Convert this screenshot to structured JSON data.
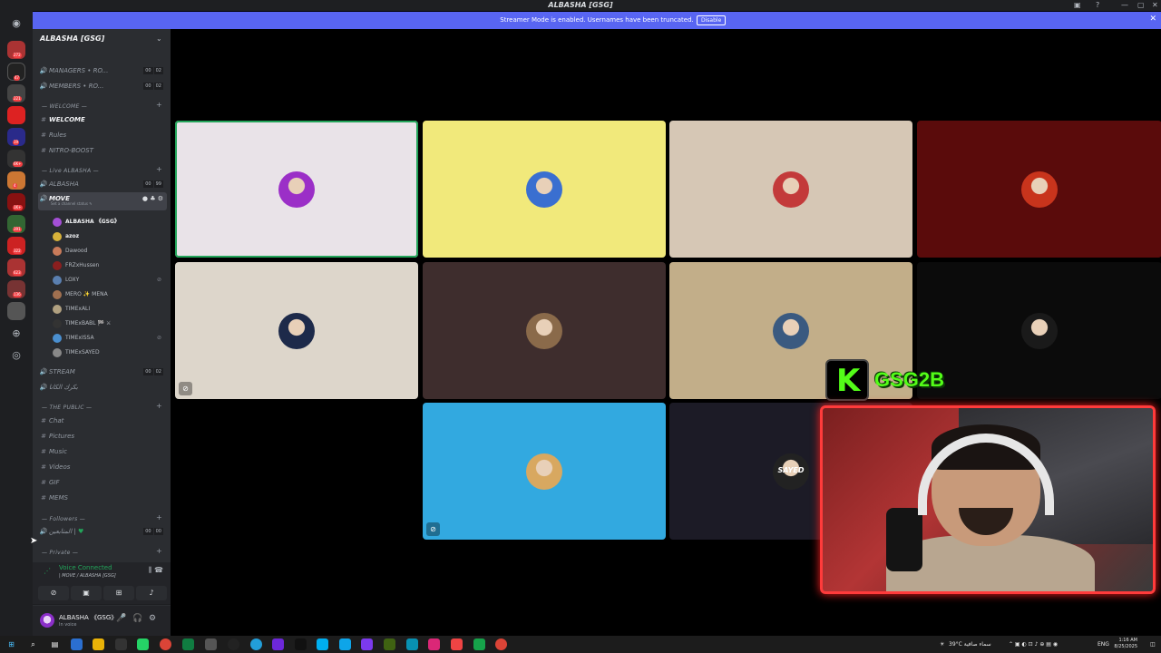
{
  "window": {
    "title": "ALBASHA [GSG]"
  },
  "banner": {
    "text": "Streamer Mode is enabled. Usernames have been truncated.",
    "button": "Disable",
    "close": "✕",
    "color": "#5865f2"
  },
  "guilds": [
    {
      "badge": "63"
    },
    {
      "badge": "272"
    },
    {
      "badge": "47"
    },
    {
      "badge": "221"
    },
    {
      "badge": ""
    },
    {
      "badge": "19"
    },
    {
      "badge": "6K+"
    },
    {
      "badge": "4"
    },
    {
      "badge": "1K+"
    },
    {
      "badge": "391"
    },
    {
      "badge": "322"
    },
    {
      "badge": "623"
    },
    {
      "badge": "136"
    },
    {
      "badge": ""
    }
  ],
  "sidebar": {
    "server_name": "ALBASHA [GSG]",
    "rows": {
      "managers": {
        "label": "MANAGERS • RO...",
        "c1": "00",
        "c2": "02"
      },
      "members": {
        "label": "MEMBERS • RO...",
        "c1": "00",
        "c2": "02"
      },
      "cat_welcome": "— WELCOME —",
      "welcome": "WELCOME",
      "rules": "Rules",
      "nitro": "NITRO-BOOST",
      "cat_live": "— Live ALBASHA —",
      "albasha": {
        "label": "ALBASHA",
        "c1": "00",
        "c2": "99"
      },
      "move": {
        "label": "MOVE",
        "status": "Set a channel status ✎"
      },
      "stream": {
        "label": "STREAM",
        "c1": "00",
        "c2": "02"
      },
      "arabic_vc": "بكرك الكانا",
      "cat_public": "— THE PUBLIC —",
      "chat": "Chat",
      "pictures": "Pictures",
      "music": "Music",
      "videos": "Videos",
      "gif": "GIF",
      "mems": "MEMS",
      "cat_followers": "— Followers —",
      "followers_vc": {
        "label": "المتابعين |",
        "c1": "00",
        "c2": "00"
      },
      "cat_private": "— Private —"
    },
    "members": [
      {
        "name": "ALBASHA 《GSG》",
        "color": "#a44fd6"
      },
      {
        "name": "azoz",
        "color": "#d8b23a"
      },
      {
        "name": "Dawood",
        "color": "#c97b5a"
      },
      {
        "name": "FRZxHussen",
        "color": "#8a1f1f"
      },
      {
        "name": "LOXY",
        "color": "#5a7fb0"
      },
      {
        "name": "MERO ✨ MENA",
        "color": "#a07050"
      },
      {
        "name": "TIMExALI",
        "color": "#b0a080"
      },
      {
        "name": "TIMExBABL 🏁 ⚔",
        "color": "#333333"
      },
      {
        "name": "TIMExISSA",
        "color": "#4a8fd0"
      },
      {
        "name": "TIMExSAYED",
        "color": "#888888"
      }
    ]
  },
  "voice_panel": {
    "title": "Voice Connected",
    "subtitle": "| MOVE / ALBASHA [GSG]"
  },
  "user_panel": {
    "name": "ALBASHA 《GSG》",
    "status": "In voice"
  },
  "tiles": [
    {
      "bg": "#e9e3e8",
      "avatar": "#9b2fc7",
      "speaking": true,
      "muted": false
    },
    {
      "bg": "#f1e97b",
      "avatar": "#3a6fd0",
      "speaking": false,
      "muted": false
    },
    {
      "bg": "#d6c7b5",
      "avatar": "#c33a3a",
      "speaking": false,
      "muted": false
    },
    {
      "bg": "#5a0b0b",
      "avatar": "#c8341c",
      "speaking": false,
      "muted": false
    },
    {
      "bg": "#ddd6cb",
      "avatar": "#1d2a4a",
      "speaking": false,
      "muted": true
    },
    {
      "bg": "#3e2d2d",
      "avatar": "#8a6a4a",
      "speaking": false,
      "muted": false
    },
    {
      "bg": "#c2ae89",
      "avatar": "#3a5a80",
      "speaking": false,
      "muted": false
    },
    {
      "bg": "#0b0b0b",
      "avatar": "#1a1a1a",
      "speaking": false,
      "muted": false
    },
    {
      "bg": "#32a9e0",
      "avatar": "#d8a860",
      "speaking": false,
      "muted": true
    },
    {
      "bg": "#1c1b26",
      "avatar": "#222222",
      "speaking": false,
      "muted": false,
      "label": "SAYED"
    }
  ],
  "overlay": {
    "kick_logo": "K",
    "kick_name": "GSG2B",
    "accent": "#53fc18"
  },
  "taskbar": {
    "weather": "39°C سماء صافية",
    "lang": "ENG",
    "time": "1:16 AM",
    "date": "8/25/2025"
  }
}
